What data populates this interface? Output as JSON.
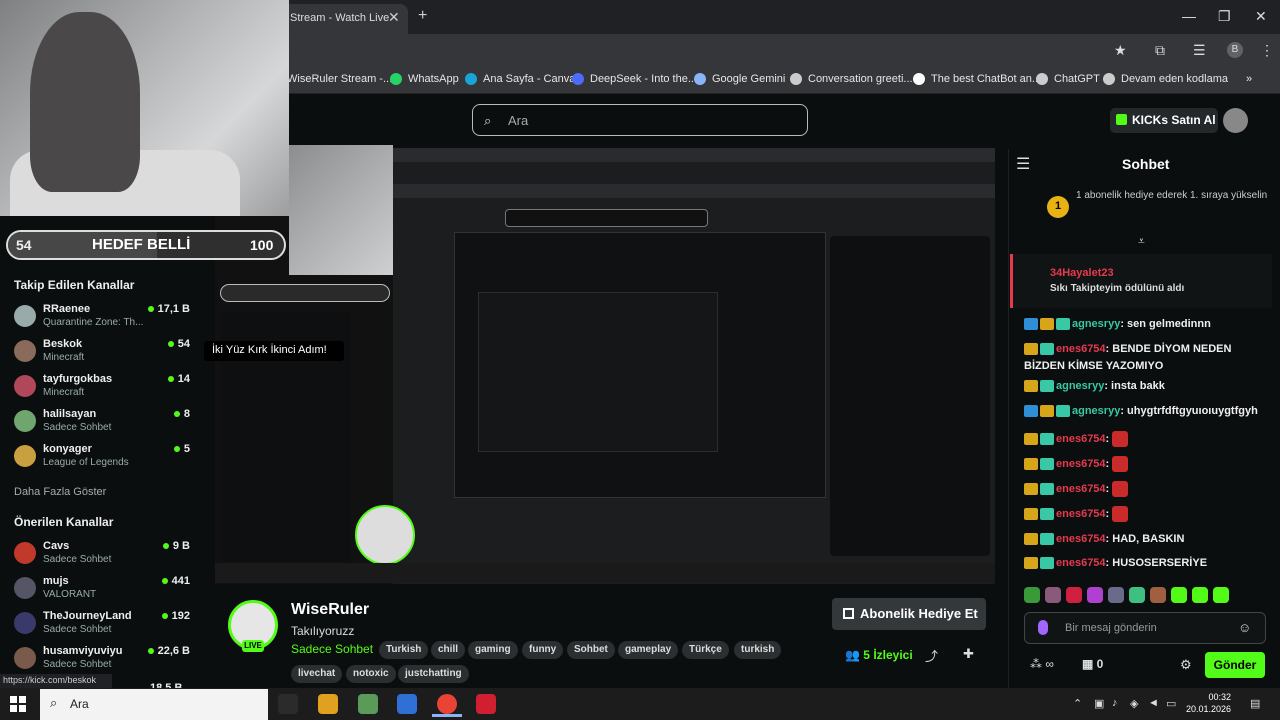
{
  "browser": {
    "tab_title": "Stream - Watch Live",
    "tab_close": "✕",
    "new_tab": "+",
    "window_controls": [
      "—",
      "❐",
      "✕"
    ],
    "toolbar_icons": [
      "★",
      "⧉",
      "☰",
      "B",
      "⋮"
    ],
    "bookmarks": [
      {
        "label": "WiseRuler Stream -...",
        "color": "#53fc18"
      },
      {
        "label": "WhatsApp",
        "color": "#25d366"
      },
      {
        "label": "Ana Sayfa - Canva",
        "color": "#1aa3d6"
      },
      {
        "label": "DeepSeek - Into the...",
        "color": "#4d6bfe"
      },
      {
        "label": "Google Gemini",
        "color": "#8ab4f8"
      },
      {
        "label": "Conversation greeti...",
        "color": "#cccccc"
      },
      {
        "label": "The best ChatBot an...",
        "color": "#ffffff"
      },
      {
        "label": "ChatGPT",
        "color": "#cccccc"
      },
      {
        "label": "Devam eden kodlama",
        "color": "#cccccc"
      }
    ],
    "bookmarks_more": "»",
    "status_url": "https://kick.com/beskok"
  },
  "header": {
    "search_placeholder": "Ara",
    "search_icon": "⌕",
    "kicks_button": "KICKs Satın Al"
  },
  "goal": {
    "current": "54",
    "label": "HEDEF BELLİ",
    "target": "100",
    "progress_fraction": 0.54
  },
  "sidebar": {
    "followed_heading": "Takip Edilen Kanallar",
    "followed": [
      {
        "name": "RRaenee",
        "category": "Quarantine Zone: Th...",
        "viewers": "17,1 B",
        "color": "#9aa"
      },
      {
        "name": "Beskok",
        "category": "Minecraft",
        "viewers": "54",
        "color": "#8a6a5a"
      },
      {
        "name": "tayfurgokbas",
        "category": "Minecraft",
        "viewers": "14",
        "color": "#b0485a"
      },
      {
        "name": "halilsayan",
        "category": "Sadece Sohbet",
        "viewers": "8",
        "color": "#6fa66f"
      },
      {
        "name": "konyager",
        "category": "League of Legends",
        "viewers": "5",
        "color": "#c8a040"
      }
    ],
    "show_more": "Daha Fazla Göster",
    "recommended_heading": "Önerilen Kanallar",
    "recommended": [
      {
        "name": "Cavs",
        "category": "Sadece Sohbet",
        "viewers": "9 B",
        "color": "#c0392b"
      },
      {
        "name": "mujs",
        "category": "VALORANT",
        "viewers": "441",
        "color": "#556"
      },
      {
        "name": "TheJourneyLand",
        "category": "Sadece Sohbet",
        "viewers": "192",
        "color": "#3a3a6a"
      },
      {
        "name": "husamviyuviyu",
        "category": "Sadece Sohbet",
        "viewers": "22,6 B",
        "color": "#7a5a4a"
      }
    ],
    "cut_off_viewers": "18,5 B"
  },
  "tooltip": "İki Yüz Kırk İkinci Adım!",
  "stream": {
    "streamer": "WiseRuler",
    "live_badge": "LIVE",
    "title": "Takılıyoruzz",
    "category": "Sadece Sohbet",
    "tags": [
      "Turkish",
      "chill",
      "gaming",
      "funny",
      "Sohbet",
      "gameplay",
      "Türkçe",
      "turkish",
      "livechat",
      "notoxic",
      "justchatting"
    ],
    "gift_button": "Abonelik Hediye Et",
    "viewers_count": "5",
    "viewers_label": "İzleyici"
  },
  "chat": {
    "title": "Sohbet",
    "pinned_rank": "1",
    "pinned_text": "1 abonelik hediye ederek 1. sıraya yükselin",
    "reward_user": "34Hayalet23",
    "reward_text": "Sıkı Takipteyim ödülünü aldı",
    "messages": [
      {
        "user": "agnesryy",
        "user_color": "cyan",
        "text": "sen gelmedinnn",
        "badges": [
          "blue",
          "gold",
          "green"
        ],
        "emote": false
      },
      {
        "user": "enes6754",
        "user_color": "red",
        "text": "BENDE DİYOM NEDEN BİZDEN KİMSE YAZOMIYO",
        "badges": [
          "gold",
          "green"
        ],
        "emote": false
      },
      {
        "user": "agnesryy",
        "user_color": "cyan",
        "text": "insta bakk",
        "badges": [
          "gold",
          "green"
        ],
        "emote": false
      },
      {
        "user": "agnesryy",
        "user_color": "cyan",
        "text": "uhygtrfdftgyuıoıuygtfgyh",
        "badges": [
          "blue",
          "gold",
          "green"
        ],
        "emote": false
      },
      {
        "user": "enes6754",
        "user_color": "red",
        "text": "",
        "badges": [
          "gold",
          "green"
        ],
        "emote": true
      },
      {
        "user": "enes6754",
        "user_color": "red",
        "text": "",
        "badges": [
          "gold",
          "green"
        ],
        "emote": true
      },
      {
        "user": "enes6754",
        "user_color": "red",
        "text": "",
        "badges": [
          "gold",
          "green"
        ],
        "emote": true
      },
      {
        "user": "enes6754",
        "user_color": "red",
        "text": "",
        "badges": [
          "gold",
          "green"
        ],
        "emote": true
      },
      {
        "user": "enes6754",
        "user_color": "red",
        "text": "HAD, BASKIN",
        "badges": [
          "gold",
          "green"
        ],
        "emote": false
      },
      {
        "user": "enes6754",
        "user_color": "red",
        "text": "HUSOSERSERİYE",
        "badges": [
          "gold",
          "green"
        ],
        "emote": false
      }
    ],
    "emote_colors": [
      "#3a9a3a",
      "#8a5a7a",
      "#d02040",
      "#b040d0",
      "#6a6a8a",
      "#40c080",
      "#a06040",
      "#53fc18",
      "#53fc18",
      "#53fc18"
    ],
    "input_placeholder": "Bir mesaj gönderin",
    "store_count": "0",
    "send_button": "Gönder"
  },
  "taskbar": {
    "search_placeholder": "Ara",
    "time": "00:32",
    "date": "20.01.2026",
    "apps": [
      "#2b2b2b",
      "#e0a020",
      "#5a9a5a",
      "#2f6fd6",
      "#ea4335",
      "#d02030"
    ]
  }
}
